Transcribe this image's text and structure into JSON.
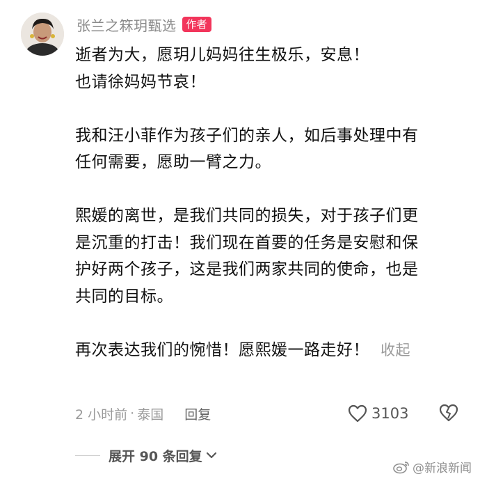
{
  "comment": {
    "username": "张兰之箖玥甄选",
    "author_badge": "作者",
    "paragraphs": [
      {
        "lines": [
          "逝者为大，愿玥儿妈妈往生极乐，安息！",
          "也请徐妈妈节哀！"
        ]
      },
      {
        "lines": [
          "我和汪小菲作为孩子们的亲人，如后事处理中有",
          "任何需要，愿助一臂之力。"
        ]
      },
      {
        "lines": [
          "熙媛的离世，是我们共同的损失，对于孩子们更",
          "是沉重的打击！我们现在首要的任务是安慰和保",
          "护好两个孩子，这是我们两家共同的使命，也是",
          "共同的目标。"
        ]
      },
      {
        "lines": [
          "再次表达我们的惋惜！愿熙媛一路走好！"
        ]
      }
    ],
    "collapse_label": "收起",
    "time": "2 小时前",
    "separator": "·",
    "location": "泰国",
    "reply_label": "回复",
    "like_count": "3103",
    "expand_replies_label": "展开 90 条回复"
  },
  "watermark": {
    "text": "@新浪新闻"
  },
  "icons": {
    "like": "heart-outline-icon",
    "dislike": "broken-heart-icon",
    "expand": "chevron-down-icon",
    "watermark": "weibo-logo-icon"
  },
  "colors": {
    "badge_bg": "#f2355b",
    "muted_text": "#9a9a9a",
    "body_text": "#111111"
  }
}
